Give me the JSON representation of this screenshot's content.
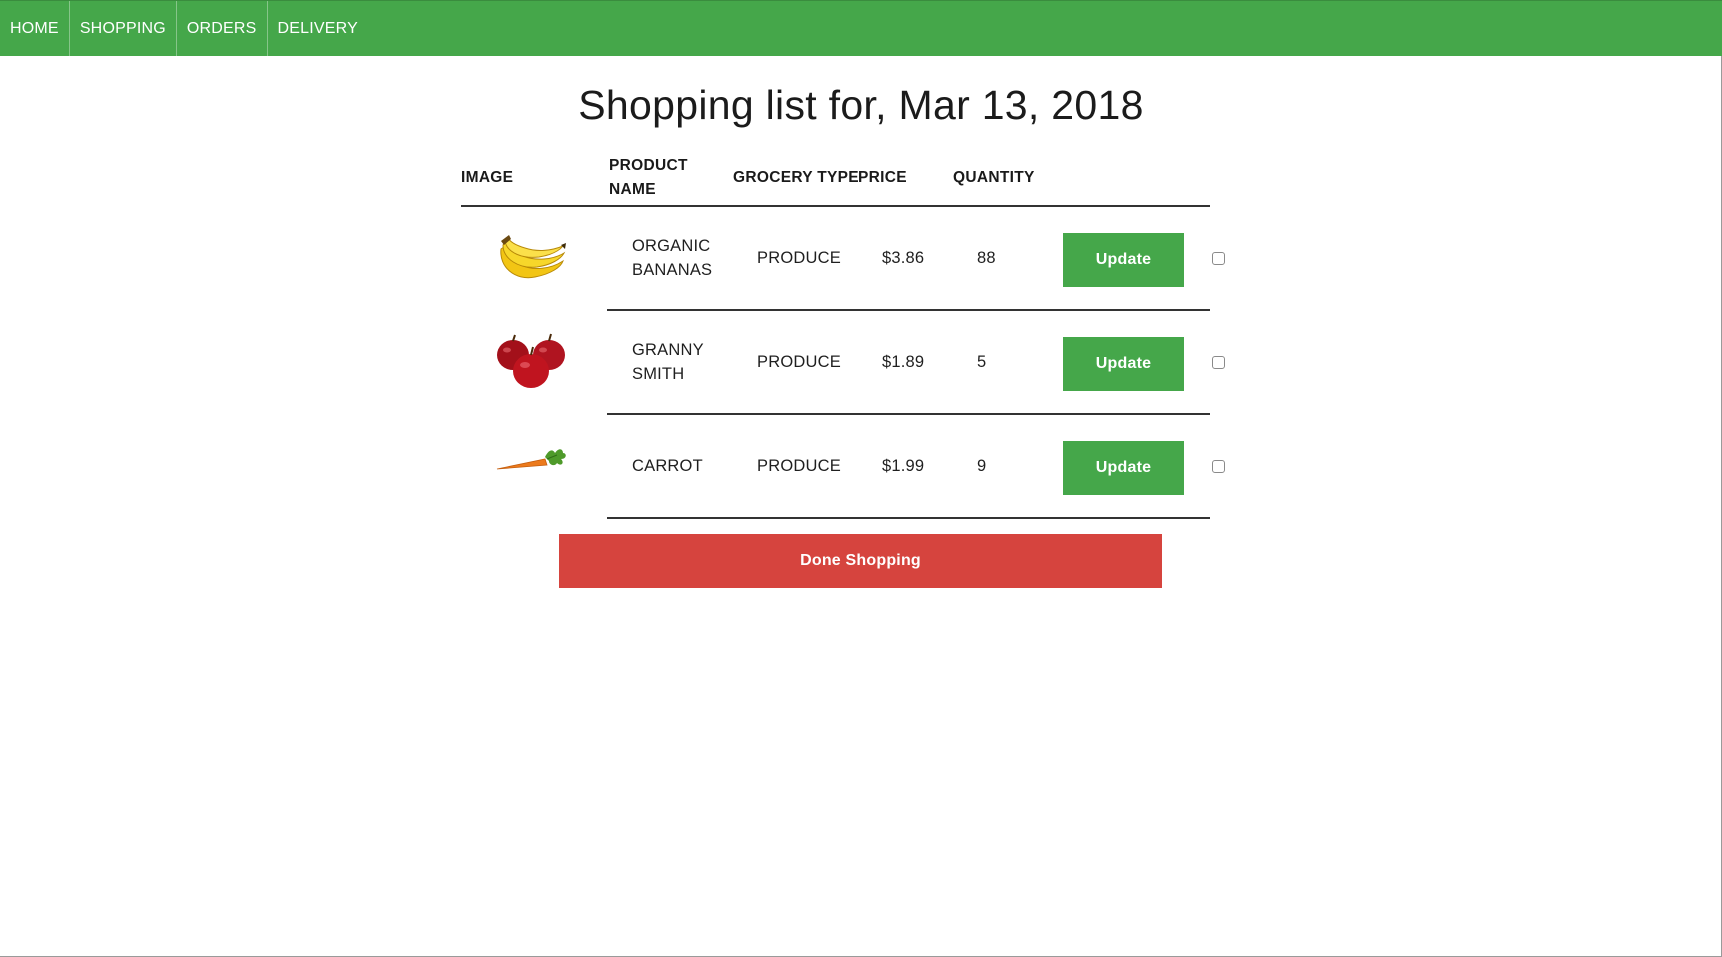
{
  "nav": {
    "items": [
      {
        "label": "HOME"
      },
      {
        "label": "SHOPPING"
      },
      {
        "label": "ORDERS"
      },
      {
        "label": "DELIVERY"
      }
    ]
  },
  "page": {
    "title": "Shopping list for, Mar 13, 2018"
  },
  "table": {
    "headers": {
      "image": "IMAGE",
      "product_name": "PRODUCT NAME",
      "grocery_type": "GROCERY TYPE",
      "price": "PRICE",
      "quantity": "QUANTITY"
    },
    "rows": [
      {
        "image_icon": "banana-icon",
        "name": "ORGANIC BANANAS",
        "type": "PRODUCE",
        "price": "$3.86",
        "quantity": "88",
        "update_label": "Update",
        "checked": false
      },
      {
        "image_icon": "apple-icon",
        "name": "GRANNY SMITH",
        "type": "PRODUCE",
        "price": "$1.89",
        "quantity": "5",
        "update_label": "Update",
        "checked": false
      },
      {
        "image_icon": "carrot-icon",
        "name": "CARROT",
        "type": "PRODUCE",
        "price": "$1.99",
        "quantity": "9",
        "update_label": "Update",
        "checked": false
      }
    ]
  },
  "actions": {
    "done_label": "Done Shopping"
  },
  "colors": {
    "brand_green": "#45a74a",
    "danger_red": "#d6443e"
  }
}
